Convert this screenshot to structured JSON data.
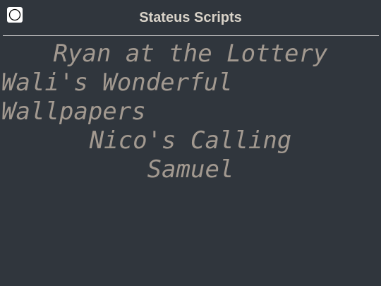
{
  "header": {
    "title": "Stateus Scripts",
    "menu_icon": "circle-icon"
  },
  "scripts": {
    "items": [
      {
        "lines": [
          "Ryan at the Lottery"
        ],
        "align": "center"
      },
      {
        "lines": [
          "Wali's Wonderful",
          "Wallpapers"
        ],
        "align": "left"
      },
      {
        "lines": [
          "Nico's Calling",
          "Samuel"
        ],
        "align": "center"
      }
    ],
    "item0_line0": "Ryan at the Lottery",
    "item1_line0": "Wali's Wonderful",
    "item1_line1": "Wallpapers",
    "item2_line0": "Nico's Calling",
    "item2_line1": "Samuel"
  },
  "colors": {
    "background": "#30363d",
    "title": "#d8d2c8",
    "item_text": "#a29990",
    "divider": "#c9c9c9"
  }
}
